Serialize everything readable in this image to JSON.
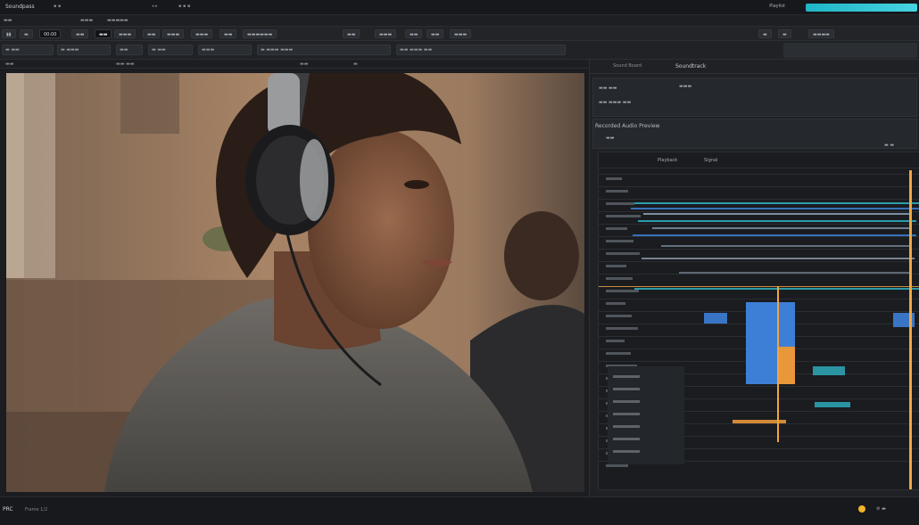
{
  "titlebar": {
    "app_name": "Soundpass",
    "window_label": "Playlist",
    "progress": 1.0,
    "accent": "#1fb5c7"
  },
  "menubar": {},
  "toolbar": {
    "timecode": "00:00"
  },
  "right_panel": {
    "title": "Soundtrack",
    "subtitle": "Sound Board",
    "section_title": "Recorded Audio Preview",
    "timeline_headers": [
      "Playback",
      "Signal"
    ]
  },
  "status": {
    "brand": "PRC",
    "text": "Frame 1/2"
  },
  "colors": {
    "track_blue": "#3d7fd6",
    "track_orange": "#e8973a",
    "track_cyan": "#2fb3c4",
    "playhead": "#f0a640"
  }
}
